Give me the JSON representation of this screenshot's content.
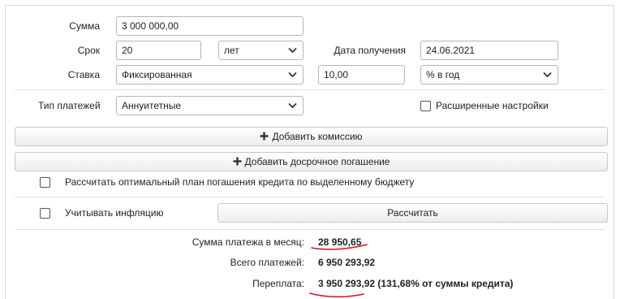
{
  "form": {
    "amount": {
      "label": "Сумма",
      "value": "3 000 000,00"
    },
    "term": {
      "label": "Срок",
      "value": "20",
      "unit": "лет"
    },
    "date": {
      "label": "Дата получения",
      "value": "24.06.2021"
    },
    "rate": {
      "label": "Ставка",
      "type": "Фиксированная",
      "value": "10,00",
      "unit": "% в год"
    },
    "payment_type": {
      "label": "Тип платежей",
      "value": "Аннуитетные"
    },
    "advanced": {
      "label": "Расширенные настройки",
      "checked": false
    }
  },
  "buttons": {
    "add_commission": "Добавить комиссию",
    "add_early_repayment": "Добавить досрочное погашение",
    "calculate": "Рассчитать"
  },
  "options": {
    "optimal_plan": {
      "label": "Рассчитать оптимальный план погашения кредита по выделенному бюджету",
      "checked": false
    },
    "inflation": {
      "label": "Учитывать инфляцию",
      "checked": false
    }
  },
  "results": {
    "monthly_label": "Сумма платежа в месяц:",
    "monthly_value": "28 950,65",
    "total_label": "Всего платежей:",
    "total_value": "6 950 293,92",
    "overpay_label": "Переплата:",
    "overpay_value": "3 950 293,92 (131,68% от суммы кредита)"
  },
  "colors": {
    "annotation": "#d4141e"
  }
}
